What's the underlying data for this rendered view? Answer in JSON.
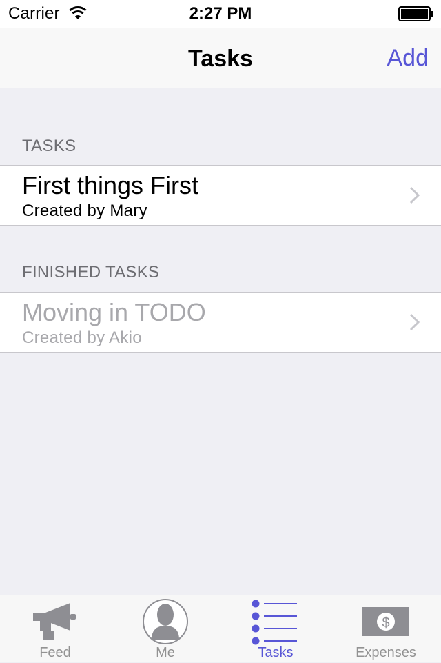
{
  "status_bar": {
    "carrier": "Carrier",
    "time": "2:27 PM"
  },
  "nav_bar": {
    "title": "Tasks",
    "add_label": "Add"
  },
  "sections": {
    "tasks": {
      "header": "TASKS",
      "items": [
        {
          "title": "First things First",
          "subtitle": "Created by Mary"
        }
      ]
    },
    "finished": {
      "header": "FINISHED TASKS",
      "items": [
        {
          "title": "Moving in TODO",
          "subtitle": "Created by Akio"
        }
      ]
    }
  },
  "tab_bar": {
    "tabs": [
      {
        "label": "Feed",
        "icon": "megaphone-icon",
        "active": false
      },
      {
        "label": "Me",
        "icon": "profile-icon",
        "active": false
      },
      {
        "label": "Tasks",
        "icon": "list-icon",
        "active": true
      },
      {
        "label": "Expenses",
        "icon": "dollar-bill-icon",
        "active": false
      }
    ]
  },
  "colors": {
    "accent": "#5856d6",
    "background": "#efeff4",
    "inactive_tab": "#929292"
  }
}
